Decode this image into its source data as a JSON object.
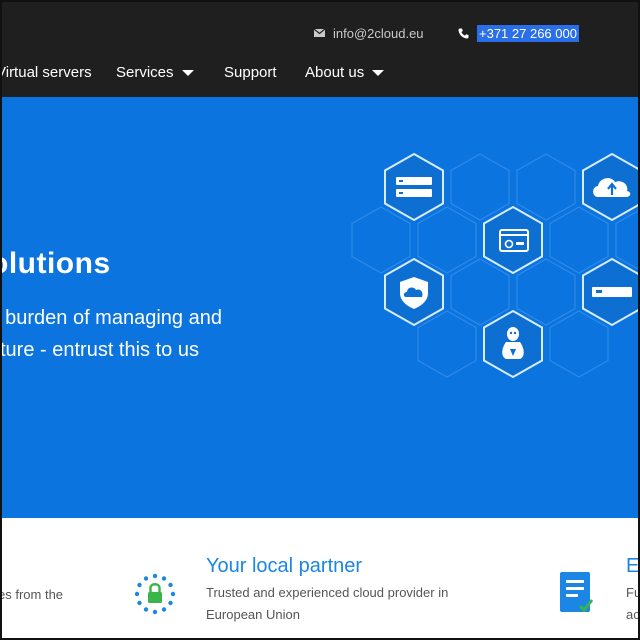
{
  "header": {
    "email": "info@2cloud.eu",
    "phone": "+371 27 266 000",
    "nav": [
      {
        "label": "Virtual servers",
        "dropdown": false
      },
      {
        "label": "Services",
        "dropdown": true
      },
      {
        "label": "Support",
        "dropdown": false
      },
      {
        "label": "About us",
        "dropdown": true
      }
    ]
  },
  "hero": {
    "title": "olutions",
    "line1": "t burden of managing and",
    "line2": "ture - entrust this to us"
  },
  "features": {
    "left_text": "es from the",
    "partner_title": "Your local partner",
    "partner_desc_1": "Trusted and experienced cloud provider in",
    "partner_desc_2": "European Union",
    "right_title": "E",
    "right_desc_1": "Fu",
    "right_desc_2": "ac"
  },
  "colors": {
    "topbar": "#1f1f1f",
    "hero": "#0b74df",
    "accent": "#1b86e3",
    "phone_highlight": "#2a6ee8"
  }
}
